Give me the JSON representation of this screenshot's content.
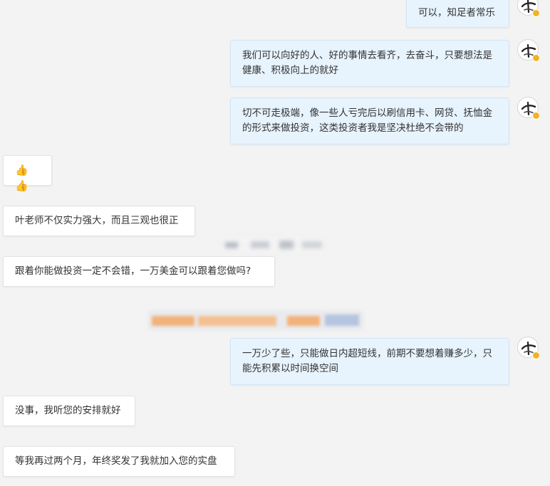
{
  "messages": [
    {
      "dir": "out",
      "text": "可以，知足者常乐"
    },
    {
      "dir": "out",
      "text": "我们可以向好的人、好的事情去看齐，去奋斗，只要想法是健康、积极向上的就好"
    },
    {
      "dir": "out",
      "text": "切不可走极端，像一些人亏完后以刷信用卡、网贷、抚恤金的形式来做投资，这类投资者我是坚决杜绝不会带的"
    },
    {
      "dir": "in",
      "text": "👍👍"
    },
    {
      "dir": "in",
      "text": "叶老师不仅实力强大，而且三观也很正"
    },
    {
      "dir": "in",
      "text": "跟着你能做投资一定不会错，一万美金可以跟着您做吗?"
    },
    {
      "dir": "out",
      "text": "一万少了些，只能做日内超短线，前期不要想着赚多少，只能先积累以时间换空间"
    },
    {
      "dir": "in",
      "text": "没事，我听您的安排就好"
    },
    {
      "dir": "in",
      "text": "等我再过两个月，年终奖发了我就加入您的实盘"
    }
  ],
  "avatar_icon": "calligraphy-avatar-icon",
  "verified_badge_icon": "verified-badge-icon",
  "colors": {
    "background": "#f3f3f3",
    "outgoing_bubble": "#e7f3fd",
    "incoming_bubble": "#ffffff",
    "badge": "#f0b323",
    "redaction_orange": "#f2b27a",
    "redaction_blue": "#b5c4e0"
  }
}
